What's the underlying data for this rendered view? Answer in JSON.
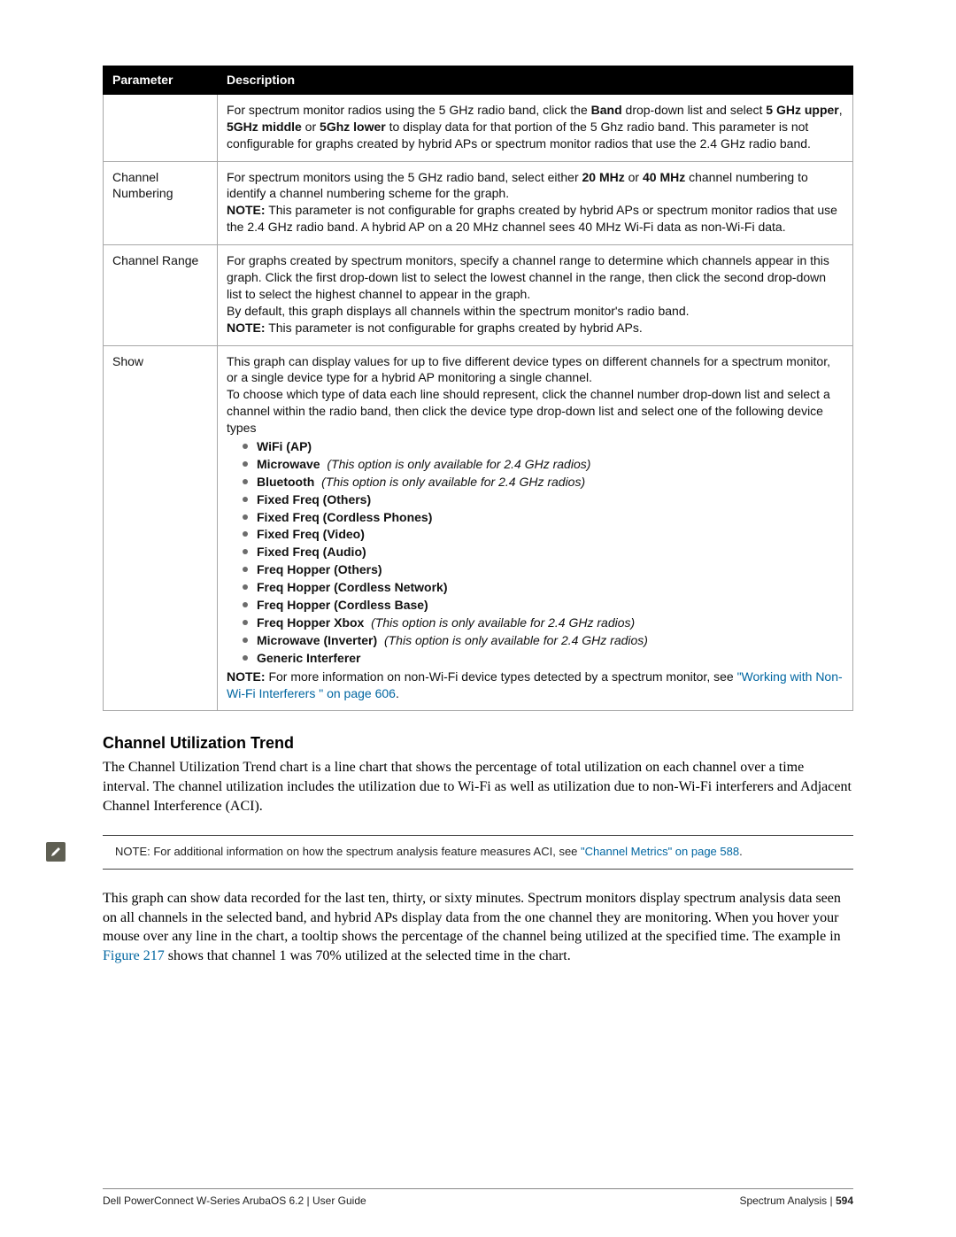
{
  "table": {
    "headers": {
      "param": "Parameter",
      "desc": "Description"
    },
    "rows": {
      "band": {
        "param": "",
        "pre": "For spectrum monitor radios using the 5 GHz radio band, click the ",
        "b1": "Band",
        "mid1": " drop-down list and select ",
        "b2": "5 GHz upper",
        "sep1": ", ",
        "b3": "5GHz middle",
        "sep2": " or ",
        "b4": "5Ghz lower",
        "post": " to display data for that portion of the 5 Ghz radio band. This parameter is not configurable for graphs created by hybrid APs or spectrum monitor radios that use the 2.4 GHz radio band."
      },
      "channel_numbering": {
        "param": "Channel Numbering",
        "pre": "For spectrum monitors using the 5 GHz radio band, select either ",
        "b1": "20 MHz",
        "or": " or ",
        "b2": "40 MHz",
        "post": " channel numbering to identify a channel numbering scheme for the graph.",
        "note_label": "NOTE:",
        "note": " This parameter is not configurable for graphs created by hybrid APs or spectrum monitor radios that use the 2.4 GHz radio band. A hybrid AP on a 20 MHz channel sees 40 MHz Wi-Fi data as non-Wi-Fi data."
      },
      "channel_range": {
        "param": "Channel Range",
        "p1": "For graphs created by spectrum monitors, specify a channel range to determine which channels appear in this graph. Click the first drop-down list to select the lowest channel in the range, then click the second drop-down list to select the highest channel to appear in the graph.",
        "p2": "By default, this graph displays all channels within the spectrum monitor's radio band.",
        "note_label": "NOTE:",
        "note": " This parameter is not configurable for graphs created by hybrid APs."
      },
      "show": {
        "param": "Show",
        "intro1": "This graph can display values for up to five different device types on different channels for a spectrum monitor, or a single device type for a hybrid AP monitoring a single channel.",
        "intro2": "To choose which type of data each line should represent, click the channel number drop-down list and select a channel within the radio band, then click the device type drop-down list and select one of the following device types",
        "items": [
          {
            "bold": "WiFi (AP)",
            "ital": ""
          },
          {
            "bold": "Microwave",
            "ital": "(This option is only available for 2.4 GHz radios)"
          },
          {
            "bold": "Bluetooth",
            "ital": "(This option is only available for 2.4 GHz radios)"
          },
          {
            "bold": "Fixed Freq (Others)",
            "ital": ""
          },
          {
            "bold": "Fixed Freq (Cordless Phones)",
            "ital": ""
          },
          {
            "bold": "Fixed Freq (Video)",
            "ital": ""
          },
          {
            "bold": "Fixed Freq (Audio)",
            "ital": ""
          },
          {
            "bold": "Freq Hopper (Others)",
            "ital": ""
          },
          {
            "bold": "Freq Hopper (Cordless Network)",
            "ital": ""
          },
          {
            "bold": "Freq Hopper (Cordless Base)",
            "ital": ""
          },
          {
            "bold": "Freq Hopper Xbox",
            "ital": "(This option is only available for 2.4 GHz radios)"
          },
          {
            "bold": "Microwave (Inverter)",
            "ital": "(This option is only available for 2.4 GHz radios)"
          },
          {
            "bold": "Generic Interferer",
            "ital": ""
          }
        ],
        "note_label": "NOTE:",
        "note_pre": " For more information on non-Wi-Fi device types detected by a spectrum monitor, see ",
        "link": "\"Working with Non-Wi-Fi Interferers \" on page 606",
        "note_post": "."
      }
    }
  },
  "section": {
    "heading": "Channel Utilization Trend",
    "para1": "The Channel Utilization Trend chart is a line chart that shows the percentage of total utilization on each channel over a time interval. The channel utilization includes the utilization due to Wi-Fi as well as utilization due to non-Wi-Fi interferers and Adjacent Channel Interference (ACI).",
    "note_pre": "NOTE: For additional information on how the spectrum analysis feature measures ACI, see ",
    "note_link": "\"Channel Metrics\" on page 588",
    "note_post": ".",
    "para2_pre": "This graph can show data recorded for the last ten, thirty, or sixty minutes. Spectrum monitors display spectrum analysis data seen on all channels in the selected band, and hybrid APs display data from the one channel they are monitoring. When you hover your mouse over any line in the chart, a tooltip shows the percentage of the channel being utilized at the specified time. The example in ",
    "para2_link": "Figure 217",
    "para2_post": " shows that channel 1 was 70% utilized at the selected time in the chart."
  },
  "footer": {
    "left": "Dell PowerConnect W-Series ArubaOS 6.2 | User Guide",
    "right_a": "Spectrum Analysis",
    "right_sep": " | ",
    "right_b": "594"
  }
}
